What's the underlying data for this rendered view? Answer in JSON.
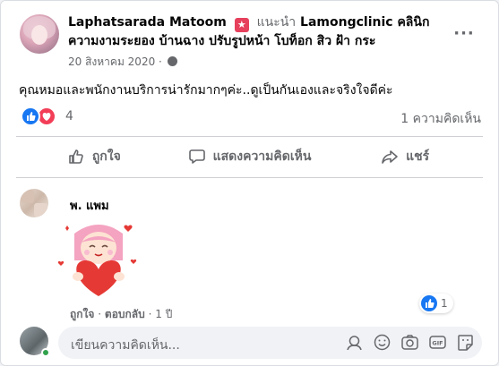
{
  "post": {
    "author": "Laphatsarada Matoom",
    "recommend": "แนะนำ",
    "page_name": "Lamongclinic คลินิกความงามระยอง บ้านฉาง ปรับรูปหน้า โบท็อก สิว ฝ้า กระ",
    "date": "20 สิงหาคม 2020 ·",
    "text": "คุณหมอและพนักงานบริการน่ารักมากๆค่ะ..ดูเป็นกันเองและจริงใจดีค่ะ",
    "reaction_count": "4",
    "comment_count": "1 ความคิดเห็น"
  },
  "actions": {
    "like": "ถูกใจ",
    "comment": "แสดงความคิดเห็น",
    "share": "แชร์"
  },
  "comment": {
    "author": "พ. แพม",
    "meta_like": "ถูกใจ",
    "meta_reply": "ตอบกลับ",
    "meta_time": "1 ปี",
    "sep": "·",
    "reaction_count": "1"
  },
  "composer": {
    "placeholder": "เขียนความคิดเห็น..."
  },
  "colors": {
    "brand_blue": "#1877f2",
    "love_red": "#f33e58",
    "text_secondary": "#65676b"
  },
  "icons": [
    "more-icon",
    "globe-icon",
    "like-reaction-icon",
    "love-reaction-icon",
    "thumb-up-icon",
    "comment-icon",
    "share-icon",
    "emoji-icon",
    "camera-icon",
    "gif-icon",
    "sticker-icon",
    "avatar-sticker-icon"
  ]
}
